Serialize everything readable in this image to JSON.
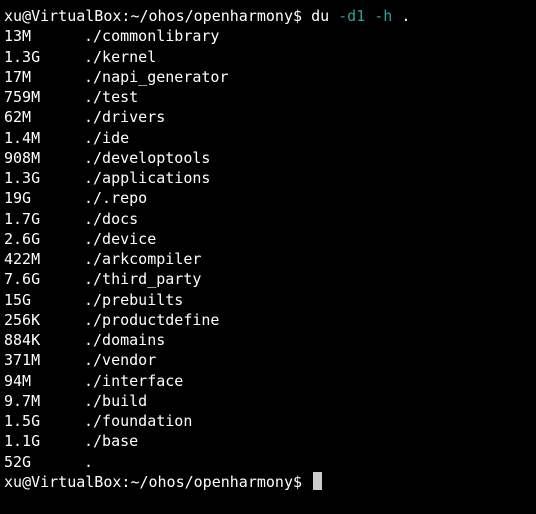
{
  "prompt1": {
    "user": "xu",
    "at": "@",
    "host": "VirtualBox",
    "colon": ":",
    "path": "~/ohos/openharmony",
    "dollar": "$",
    "cmd": "du",
    "flag1": "-d1",
    "flag2": "-h",
    "arg": "."
  },
  "rows": [
    {
      "size": "13M",
      "path": "./commonlibrary"
    },
    {
      "size": "1.3G",
      "path": "./kernel"
    },
    {
      "size": "17M",
      "path": "./napi_generator"
    },
    {
      "size": "759M",
      "path": "./test"
    },
    {
      "size": "62M",
      "path": "./drivers"
    },
    {
      "size": "1.4M",
      "path": "./ide"
    },
    {
      "size": "908M",
      "path": "./developtools"
    },
    {
      "size": "1.3G",
      "path": "./applications"
    },
    {
      "size": "19G",
      "path": "./.repo"
    },
    {
      "size": "1.7G",
      "path": "./docs"
    },
    {
      "size": "2.6G",
      "path": "./device"
    },
    {
      "size": "422M",
      "path": "./arkcompiler"
    },
    {
      "size": "7.6G",
      "path": "./third_party"
    },
    {
      "size": "15G",
      "path": "./prebuilts"
    },
    {
      "size": "256K",
      "path": "./productdefine"
    },
    {
      "size": "884K",
      "path": "./domains"
    },
    {
      "size": "371M",
      "path": "./vendor"
    },
    {
      "size": "94M",
      "path": "./interface"
    },
    {
      "size": "9.7M",
      "path": "./build"
    },
    {
      "size": "1.5G",
      "path": "./foundation"
    },
    {
      "size": "1.1G",
      "path": "./base"
    },
    {
      "size": "52G",
      "path": "."
    }
  ],
  "prompt2": {
    "user": "xu",
    "at": "@",
    "host": "VirtualBox",
    "colon": ":",
    "path": "~/ohos/openharmony",
    "dollar": "$"
  }
}
